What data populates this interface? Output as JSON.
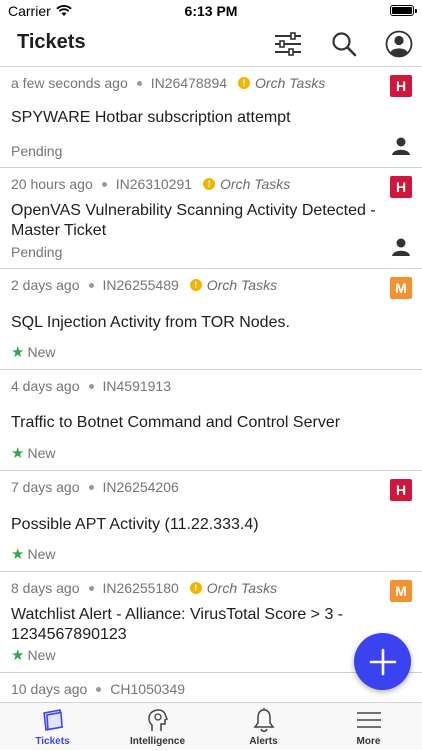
{
  "status_bar": {
    "carrier": "Carrier",
    "time": "6:13 PM"
  },
  "header": {
    "title": "Tickets"
  },
  "tickets": [
    {
      "time": "a few seconds ago",
      "id": "IN26478894",
      "orch": "Orch Tasks",
      "title": "SPYWARE Hotbar subscription attempt",
      "status": "Pending",
      "priority": "H",
      "assigned": true
    },
    {
      "time": "20 hours ago",
      "id": "IN26310291",
      "orch": "Orch Tasks",
      "title": "OpenVAS Vulnerability Scanning Activity Detected - Master Ticket",
      "status": "Pending",
      "priority": "H",
      "assigned": true
    },
    {
      "time": "2 days ago",
      "id": "IN26255489",
      "orch": "Orch Tasks",
      "title": "SQL Injection Activity from TOR Nodes.",
      "status": "New",
      "priority": "M",
      "assigned": false
    },
    {
      "time": "4 days ago",
      "id": "IN4591913",
      "orch": "",
      "title": "Traffic to Botnet Command and Control Server",
      "status": "New",
      "priority": "",
      "assigned": false
    },
    {
      "time": "7 days ago",
      "id": "IN26254206",
      "orch": "",
      "title": "Possible APT Activity (11.22.333.4)",
      "status": "New",
      "priority": "H",
      "assigned": false
    },
    {
      "time": "8 days ago",
      "id": "IN26255180",
      "orch": "Orch Tasks",
      "title": "Watchlist Alert - Alliance: VirusTotal Score > 3 - 1234567890123",
      "status": "New",
      "priority": "M",
      "assigned": false
    },
    {
      "time": "10 days ago",
      "id": "CH1050349",
      "orch": "",
      "title": "",
      "status": "",
      "priority": "",
      "assigned": false
    }
  ],
  "tabs": [
    {
      "label": "Tickets",
      "icon": "tickets-icon",
      "active": true
    },
    {
      "label": "Intelligence",
      "icon": "intelligence-icon",
      "active": false
    },
    {
      "label": "Alerts",
      "icon": "bell-icon",
      "active": false
    },
    {
      "label": "More",
      "icon": "menu-icon",
      "active": false
    }
  ],
  "colors": {
    "accent": "#3b43f0",
    "high": "#d0173a",
    "medium": "#f5922f",
    "new_star": "#2fa84f",
    "orch": "#f3b600"
  }
}
